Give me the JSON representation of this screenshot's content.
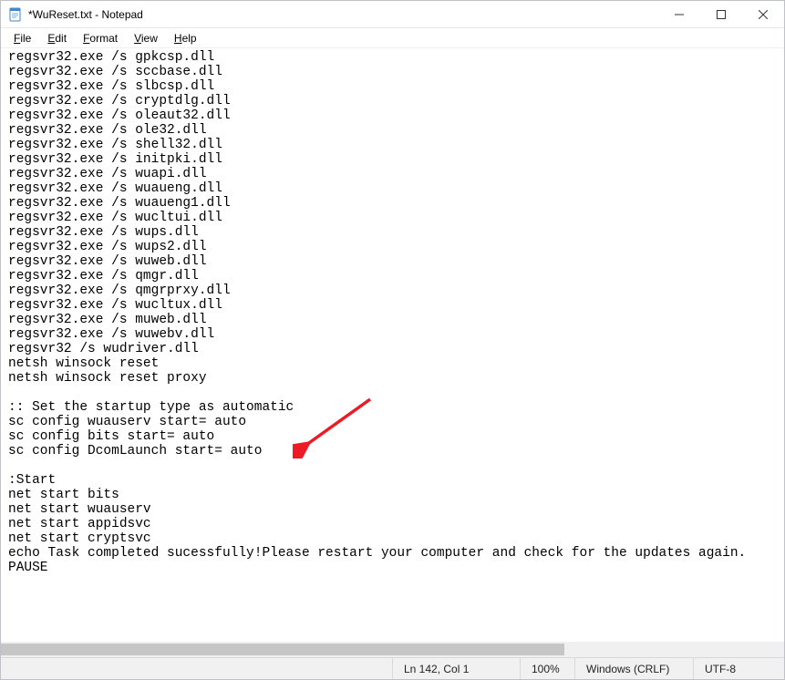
{
  "window": {
    "title": "*WuReset.txt - Notepad"
  },
  "menu": {
    "file": "File",
    "edit": "Edit",
    "format": "Format",
    "view": "View",
    "help": "Help"
  },
  "editor": {
    "content": "regsvr32.exe /s gpkcsp.dll\nregsvr32.exe /s sccbase.dll\nregsvr32.exe /s slbcsp.dll\nregsvr32.exe /s cryptdlg.dll\nregsvr32.exe /s oleaut32.dll\nregsvr32.exe /s ole32.dll\nregsvr32.exe /s shell32.dll\nregsvr32.exe /s initpki.dll\nregsvr32.exe /s wuapi.dll\nregsvr32.exe /s wuaueng.dll\nregsvr32.exe /s wuaueng1.dll\nregsvr32.exe /s wucltui.dll\nregsvr32.exe /s wups.dll\nregsvr32.exe /s wups2.dll\nregsvr32.exe /s wuweb.dll\nregsvr32.exe /s qmgr.dll\nregsvr32.exe /s qmgrprxy.dll\nregsvr32.exe /s wucltux.dll\nregsvr32.exe /s muweb.dll\nregsvr32.exe /s wuwebv.dll\nregsvr32 /s wudriver.dll\nnetsh winsock reset\nnetsh winsock reset proxy\n\n:: Set the startup type as automatic\nsc config wuauserv start= auto\nsc config bits start= auto\nsc config DcomLaunch start= auto\n\n:Start\nnet start bits\nnet start wuauserv\nnet start appidsvc\nnet start cryptsvc\necho Task completed sucessfully!Please restart your computer and check for the updates again.\nPAUSE"
  },
  "status": {
    "position": "Ln 142, Col 1",
    "zoom": "100%",
    "line_ending": "Windows (CRLF)",
    "encoding": "UTF-8"
  },
  "annotation": {
    "arrow_color": "#ed1c24"
  }
}
